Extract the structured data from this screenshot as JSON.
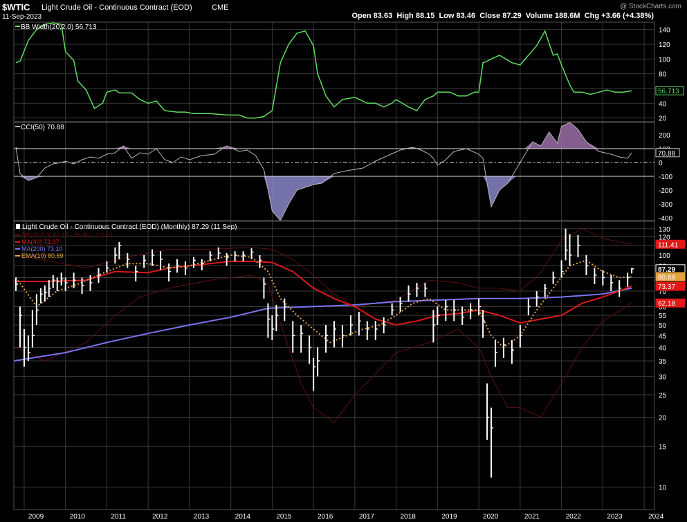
{
  "header": {
    "symbol": "$WTIC",
    "name": "Light Crude Oil - Continuous Contract (EOD)",
    "exchange": "CME",
    "date": "11-Sep-2023",
    "watermark": "@ StockCharts.com",
    "quote": [
      {
        "label": "Open",
        "value": "83.63"
      },
      {
        "label": "High",
        "value": "88.15"
      },
      {
        "label": "Low",
        "value": "83.46"
      },
      {
        "label": "Close",
        "value": "87.29"
      },
      {
        "label": "Volume",
        "value": "188.6M"
      },
      {
        "label": "Chg",
        "value": "+3.66 (+4.38%)"
      }
    ]
  },
  "colors": {
    "background": "#000000",
    "grid": "#3a3a3a",
    "bbwidth": "#5fdc5f",
    "cci": "#b8b8b8",
    "cci_fill": "#8a86c8",
    "cci_fill_top": "#9a6fa8",
    "ma40": "#e01818",
    "ma200": "#7a74f0",
    "ema10": "#e6a23c",
    "bollinger": "#5a1010",
    "price": "#ffffff"
  },
  "chart_data": [
    {
      "type": "line",
      "panel": "bb-width",
      "legend": "BB Width(20,2.0) 56.713",
      "last_value": "56.713",
      "ylim": [
        15,
        150
      ],
      "yticks": [
        20,
        40,
        60,
        80,
        100,
        120,
        140
      ],
      "x": [
        2008.8,
        2008.9,
        2009.1,
        2009.3,
        2009.5,
        2009.7,
        2009.9,
        2010.0,
        2010.2,
        2010.3,
        2010.5,
        2010.7,
        2010.9,
        2011.0,
        2011.2,
        2011.3,
        2011.6,
        2011.8,
        2012.0,
        2012.2,
        2012.4,
        2012.7,
        2012.9,
        2013.1,
        2013.5,
        2013.9,
        2014.2,
        2014.4,
        2014.6,
        2014.8,
        2015.0,
        2015.2,
        2015.4,
        2015.6,
        2015.8,
        2016.0,
        2016.1,
        2016.3,
        2016.5,
        2016.7,
        2017.0,
        2017.3,
        2017.5,
        2017.7,
        2017.9,
        2018.0,
        2018.3,
        2018.5,
        2018.7,
        2018.9,
        2019.0,
        2019.3,
        2019.5,
        2019.7,
        2019.9,
        2020.0,
        2020.1,
        2020.2,
        2020.3,
        2020.5,
        2020.8,
        2021.0,
        2021.2,
        2021.4,
        2021.6,
        2021.8,
        2021.9,
        2022.0,
        2022.2,
        2022.3,
        2022.5,
        2022.7,
        2022.9,
        2023.1,
        2023.3,
        2023.5,
        2023.7
      ],
      "values": [
        95,
        97,
        125,
        140,
        147,
        149,
        147,
        110,
        98,
        70,
        58,
        33,
        40,
        55,
        58,
        54,
        54,
        45,
        40,
        43,
        30,
        28,
        28,
        26,
        26,
        24,
        24,
        20,
        20,
        22,
        30,
        95,
        120,
        135,
        138,
        118,
        80,
        50,
        35,
        45,
        48,
        40,
        40,
        35,
        40,
        45,
        35,
        30,
        45,
        50,
        55,
        55,
        50,
        50,
        55,
        55,
        95,
        97,
        100,
        105,
        95,
        92,
        105,
        118,
        138,
        105,
        107,
        92,
        65,
        55,
        55,
        52,
        55,
        58,
        55,
        55,
        57
      ],
      "series": [
        {
          "name": "BB Width(20,2.0)"
        }
      ]
    },
    {
      "type": "area",
      "panel": "cci",
      "legend": "CCI(50) 70.88",
      "last_value": "70.88",
      "ylim": [
        -420,
        290
      ],
      "yticks": [
        -400,
        -300,
        -200,
        -100,
        0,
        100,
        200
      ],
      "reference_lines": [
        100,
        0,
        -100
      ],
      "x": [
        2008.8,
        2008.9,
        2009.1,
        2009.3,
        2009.5,
        2009.7,
        2009.9,
        2010.0,
        2010.2,
        2010.4,
        2010.6,
        2010.8,
        2011.0,
        2011.2,
        2011.4,
        2011.6,
        2011.8,
        2012.0,
        2012.2,
        2012.4,
        2012.6,
        2012.8,
        2013.0,
        2013.3,
        2013.6,
        2013.9,
        2014.2,
        2014.4,
        2014.6,
        2014.8,
        2014.9,
        2015.0,
        2015.2,
        2015.4,
        2015.6,
        2015.8,
        2016.0,
        2016.2,
        2016.5,
        2016.8,
        2017.2,
        2017.5,
        2017.8,
        2018.1,
        2018.4,
        2018.6,
        2018.8,
        2018.9,
        2019.0,
        2019.2,
        2019.4,
        2019.7,
        2020.0,
        2020.1,
        2020.2,
        2020.3,
        2020.5,
        2020.7,
        2020.9,
        2021.1,
        2021.3,
        2021.5,
        2021.7,
        2021.9,
        2022.0,
        2022.2,
        2022.4,
        2022.6,
        2022.9,
        2023.2,
        2023.4,
        2023.6,
        2023.7
      ],
      "values": [
        110,
        -80,
        -130,
        -110,
        -40,
        -10,
        0,
        10,
        -10,
        20,
        40,
        30,
        60,
        70,
        120,
        30,
        70,
        60,
        100,
        20,
        0,
        40,
        20,
        50,
        60,
        120,
        80,
        90,
        50,
        -50,
        -200,
        -350,
        -420,
        -300,
        -200,
        -180,
        -160,
        -150,
        -80,
        -60,
        -40,
        10,
        50,
        90,
        110,
        90,
        60,
        30,
        -20,
        20,
        80,
        100,
        60,
        30,
        -150,
        -320,
        -200,
        -150,
        -50,
        50,
        150,
        120,
        220,
        140,
        260,
        290,
        240,
        150,
        80,
        60,
        40,
        30,
        70
      ]
    },
    {
      "type": "bar",
      "panel": "price",
      "legend": "Light Crude Oil - Continuous Contract (EOD) (Monthly) 87.29 (11 Sep)",
      "scale": "log",
      "ylim": [
        8,
        140
      ],
      "yticks": [
        10,
        15,
        20,
        25,
        30,
        35,
        40,
        45,
        50,
        55,
        60,
        70,
        80,
        90,
        100,
        110,
        120,
        130
      ],
      "xticks": [
        "2009",
        "2010",
        "2011",
        "2012",
        "2013",
        "2014",
        "2015",
        "2016",
        "2017",
        "2018",
        "2019",
        "2020",
        "2021",
        "2022",
        "2023",
        "2024"
      ],
      "xlim": [
        2008.75,
        2024.25
      ],
      "indicators": [
        {
          "name": "BB(20,2.0) 62.18 - 86.80 - 111.41",
          "color_key": "bollinger"
        },
        {
          "name": "MA(40) 73.37",
          "color_key": "ma40"
        },
        {
          "name": "MA(200) 73.10",
          "color_key": "ma200"
        },
        {
          "name": "EMA(10) 80.69",
          "color_key": "ema10"
        }
      ],
      "price_labels": [
        {
          "value": 111.41,
          "text": "111.41",
          "color_key": "ma40"
        },
        {
          "value": 87.29,
          "text": "87.29",
          "color_key": "price"
        },
        {
          "value": 80.69,
          "text": "80.69",
          "color_key": "ema10"
        },
        {
          "value": 73.37,
          "text": "73.37",
          "color_key": "ma40"
        },
        {
          "value": 62.18,
          "text": "62.18",
          "color_key": "ma40"
        }
      ],
      "close": {
        "x": [
          2008.8,
          2008.9,
          2009.0,
          2009.1,
          2009.2,
          2009.3,
          2009.4,
          2009.5,
          2009.6,
          2009.7,
          2009.8,
          2009.9,
          2010.0,
          2010.2,
          2010.4,
          2010.6,
          2010.8,
          2011.0,
          2011.2,
          2011.3,
          2011.5,
          2011.7,
          2011.9,
          2012.1,
          2012.3,
          2012.5,
          2012.7,
          2012.9,
          2013.1,
          2013.3,
          2013.5,
          2013.7,
          2013.9,
          2014.1,
          2014.3,
          2014.5,
          2014.7,
          2014.8,
          2014.9,
          2015.0,
          2015.1,
          2015.3,
          2015.5,
          2015.7,
          2015.9,
          2016.0,
          2016.1,
          2016.3,
          2016.5,
          2016.7,
          2016.9,
          2017.1,
          2017.3,
          2017.5,
          2017.7,
          2017.9,
          2018.1,
          2018.3,
          2018.5,
          2018.7,
          2018.9,
          2019.0,
          2019.2,
          2019.4,
          2019.6,
          2019.8,
          2020.0,
          2020.1,
          2020.2,
          2020.3,
          2020.4,
          2020.6,
          2020.8,
          2021.0,
          2021.2,
          2021.4,
          2021.6,
          2021.8,
          2022.0,
          2022.1,
          2022.2,
          2022.4,
          2022.6,
          2022.8,
          2023.0,
          2023.2,
          2023.4,
          2023.6,
          2023.7
        ],
        "values": [
          75,
          55,
          40,
          38,
          45,
          58,
          68,
          69,
          72,
          78,
          77,
          79,
          76,
          78,
          74,
          76,
          82,
          88,
          100,
          110,
          96,
          85,
          95,
          100,
          96,
          85,
          90,
          88,
          95,
          92,
          100,
          102,
          98,
          100,
          100,
          103,
          95,
          75,
          53,
          48,
          55,
          60,
          45,
          46,
          40,
          33,
          35,
          45,
          48,
          45,
          50,
          52,
          48,
          48,
          50,
          58,
          62,
          68,
          72,
          72,
          50,
          55,
          60,
          58,
          54,
          58,
          60,
          52,
          20,
          18,
          38,
          41,
          39,
          45,
          60,
          66,
          72,
          80,
          85,
          105,
          100,
          110,
          90,
          82,
          80,
          76,
          72,
          80,
          87.29
        ],
        "low": [
          70,
          40,
          33,
          35,
          40,
          50,
          62,
          63,
          66,
          72,
          70,
          74,
          70,
          72,
          68,
          70,
          76,
          84,
          92,
          96,
          88,
          77,
          88,
          90,
          86,
          77,
          84,
          82,
          88,
          86,
          94,
          96,
          90,
          94,
          94,
          96,
          88,
          65,
          44,
          43,
          47,
          52,
          38,
          38,
          34,
          26,
          30,
          38,
          40,
          40,
          45,
          45,
          43,
          43,
          46,
          55,
          57,
          63,
          66,
          66,
          42,
          50,
          52,
          52,
          50,
          53,
          55,
          44,
          16,
          11,
          33,
          36,
          34,
          40,
          55,
          60,
          66,
          75,
          80,
          95,
          90,
          98,
          82,
          75,
          74,
          70,
          66,
          73,
          83.46
        ],
        "high": [
          80,
          60,
          48,
          45,
          58,
          68,
          72,
          74,
          78,
          82,
          80,
          84,
          80,
          84,
          80,
          82,
          88,
          94,
          108,
          114,
          102,
          90,
          100,
          106,
          104,
          92,
          96,
          94,
          98,
          96,
          104,
          108,
          102,
          104,
          104,
          107,
          100,
          80,
          62,
          55,
          61,
          65,
          52,
          50,
          45,
          36,
          40,
          50,
          52,
          50,
          55,
          57,
          52,
          52,
          54,
          62,
          66,
          74,
          76,
          76,
          58,
          60,
          64,
          64,
          60,
          62,
          65,
          58,
          28,
          22,
          43,
          44,
          43,
          50,
          65,
          70,
          75,
          85,
          95,
          130,
          123,
          122,
          100,
          88,
          86,
          82,
          78,
          84,
          88.15
        ]
      },
      "ma200": {
        "x": [
          2008.75,
          2010.0,
          2011.0,
          2012.0,
          2013.0,
          2014.0,
          2014.9,
          2016.0,
          2017.0,
          2018.0,
          2019.0,
          2020.0,
          2021.0,
          2022.0,
          2023.0,
          2023.7
        ],
        "values": [
          35,
          38,
          42,
          46,
          50,
          54,
          59,
          60,
          61,
          63,
          64,
          65,
          65,
          66,
          68,
          72
        ]
      },
      "ma40": {
        "x": [
          2008.75,
          2009.5,
          2010.5,
          2011.2,
          2012.0,
          2012.5,
          2013.0,
          2013.5,
          2014.0,
          2014.5,
          2015.0,
          2015.5,
          2016.0,
          2016.5,
          2017.0,
          2017.5,
          2018.0,
          2018.5,
          2019.0,
          2019.5,
          2020.0,
          2020.5,
          2021.0,
          2021.5,
          2022.0,
          2022.5,
          2023.0,
          2023.7
        ],
        "values": [
          77,
          77,
          78,
          85,
          84,
          88,
          90,
          92,
          94,
          94,
          93,
          85,
          72,
          65,
          60,
          53,
          50,
          52,
          55,
          56,
          58,
          55,
          51,
          53,
          55,
          62,
          66,
          73.37
        ]
      },
      "ema10": {
        "x": [
          2008.8,
          2009.3,
          2009.8,
          2010.3,
          2011.0,
          2011.5,
          2012.0,
          2012.5,
          2013.0,
          2013.5,
          2014.0,
          2014.5,
          2014.9,
          2015.2,
          2015.6,
          2016.0,
          2016.4,
          2016.8,
          2017.2,
          2017.6,
          2018.0,
          2018.4,
          2018.8,
          2019.2,
          2019.6,
          2020.0,
          2020.3,
          2020.6,
          2021.0,
          2021.4,
          2021.8,
          2022.2,
          2022.6,
          2023.0,
          2023.4,
          2023.7
        ],
        "values": [
          80,
          60,
          70,
          75,
          85,
          92,
          92,
          88,
          90,
          95,
          100,
          98,
          85,
          65,
          55,
          48,
          42,
          45,
          48,
          50,
          55,
          62,
          65,
          58,
          58,
          58,
          45,
          40,
          45,
          58,
          72,
          90,
          95,
          85,
          80,
          80.69
        ]
      },
      "bb_upper": {
        "x": [
          2008.8,
          2009.5,
          2010.5,
          2011.5,
          2012.5,
          2013.5,
          2014.5,
          2015.0,
          2015.5,
          2016.0,
          2016.5,
          2017.0,
          2018.0,
          2018.8,
          2019.5,
          2020.0,
          2020.5,
          2021.0,
          2021.5,
          2022.0,
          2022.5,
          2023.0,
          2023.7
        ],
        "values": [
          100,
          95,
          88,
          98,
          106,
          106,
          108,
          106,
          96,
          82,
          68,
          60,
          64,
          78,
          76,
          72,
          72,
          70,
          84,
          116,
          130,
          118,
          111.41
        ]
      },
      "bb_lower": {
        "x": [
          2008.8,
          2009.5,
          2010.5,
          2011.2,
          2011.8,
          2012.5,
          2013.5,
          2014.5,
          2014.9,
          2015.3,
          2015.7,
          2016.0,
          2016.5,
          2017.0,
          2018.0,
          2018.8,
          2019.5,
          2020.0,
          2020.3,
          2020.7,
          2021.0,
          2021.5,
          2022.0,
          2022.5,
          2023.0,
          2023.7
        ],
        "values": [
          40,
          35,
          42,
          55,
          66,
          72,
          78,
          82,
          75,
          45,
          28,
          22,
          19,
          25,
          38,
          42,
          48,
          40,
          30,
          22,
          22,
          20,
          28,
          40,
          52,
          62.18
        ]
      }
    }
  ]
}
